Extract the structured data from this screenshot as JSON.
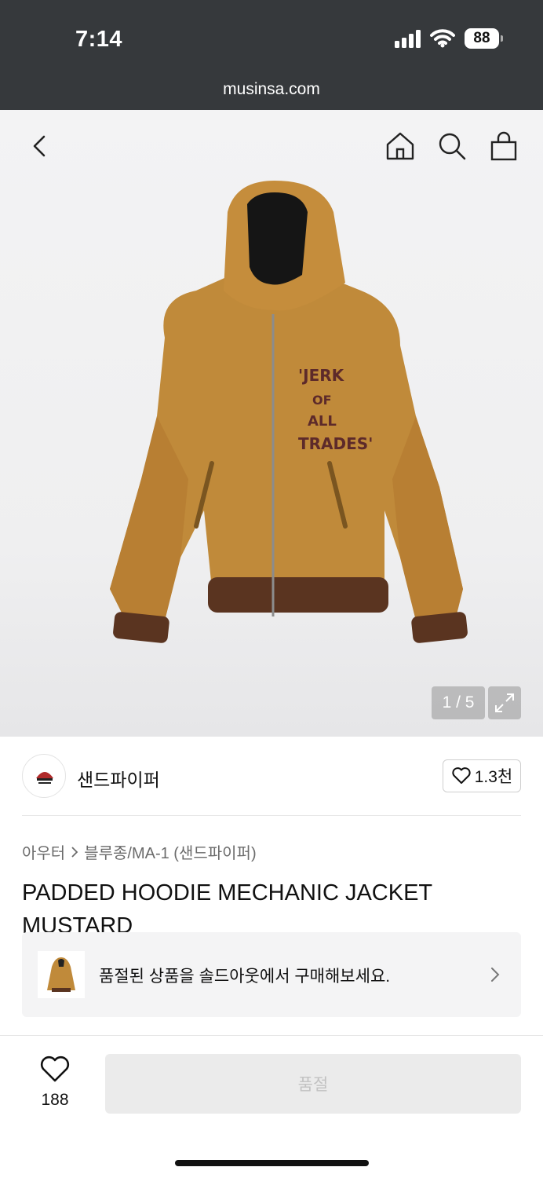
{
  "status_bar": {
    "time": "7:14",
    "battery": "88"
  },
  "browser": {
    "url": "musinsa.com"
  },
  "gallery": {
    "counter": "1 / 5",
    "jacket_print": [
      "'JERK",
      "OF",
      "ALL",
      "TRADES'"
    ]
  },
  "brand": {
    "name": "샌드파이퍼",
    "like_count": "1.3천"
  },
  "breadcrumb": {
    "category": "아우터",
    "subcategory": "블루종/MA-1 (샌드파이퍼)"
  },
  "product": {
    "title": "PADDED HOODIE MECHANIC JACKET MUSTARD"
  },
  "soldout_banner": {
    "text": "품절된 상품을 솔드아웃에서 구매해보세요."
  },
  "bottom_bar": {
    "wish_count": "188",
    "buy_label": "품절"
  },
  "colors": {
    "mustard": "#c08a3a",
    "rib": "#5a3420",
    "dark_status": "#36393c"
  }
}
